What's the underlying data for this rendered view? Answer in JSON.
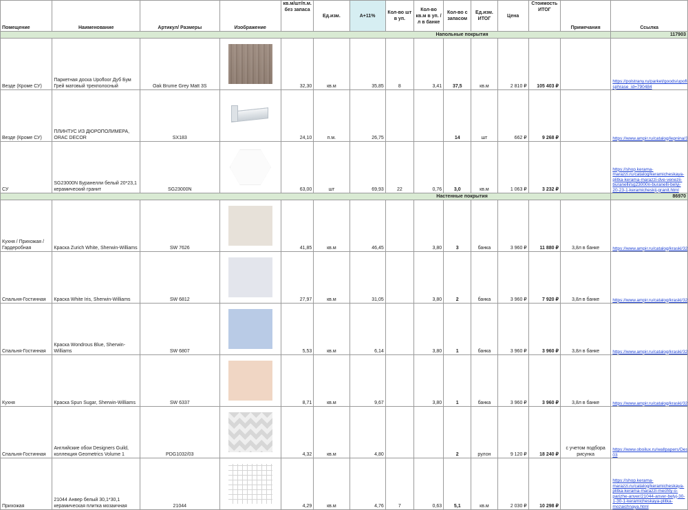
{
  "headers": {
    "room": "Помещение",
    "name": "Наименование",
    "article": "Артикул/ Размеры",
    "image": "Изображение",
    "qty": "кв.м/шт/п.м. без запаса",
    "unit": "Ед.изм.",
    "a11": "А+11%",
    "pcs_pack": "Кол-во шт в уп.",
    "sqm_pack": "Кол-во кв.м в уп. / л в банке",
    "qty_reserve": "Кол-во с запасом",
    "unit_total": "Ед.изм. ИТОГ",
    "price": "Цена",
    "cost": "Стоимость ИТОГ",
    "notes": "Примечания",
    "link": "Ссылка"
  },
  "colors": {
    "section_bg": "#d9ead3",
    "a11_bg": "#d6eef2",
    "link": "#1a3fd6"
  },
  "sections": [
    {
      "title": "Напольные покрытия",
      "total": "117903",
      "rows": [
        {
          "room": "Везде (Кроме СУ)",
          "name": "Паркетная доска Upofloor Дуб Бум Грей матовый трехполосный",
          "article": "Oak Brume Grey Matt 3S",
          "image": "wood-swatch",
          "qty": "32,30",
          "unit": "кв.м",
          "a11": "35,85",
          "pcs": "8",
          "sqm": "3,41",
          "reserve": "37,5",
          "unit_total": "кв.м",
          "price": "2 810 ₽",
          "cost": "105 403 ₽",
          "notes": "",
          "link": "https://polstrany.ru/parket/goods/upofloor_dub_bum_grey_matoviy_trekhpolosnyy_oak_brume_grey_matt_3s/?sphrase_id=790484"
        },
        {
          "room": "Везде (Кроме СУ)",
          "name": "ПЛИНТУС ИЗ ДЮРОПОЛИМЕРА, ORAC DECOR",
          "article": "SX183",
          "image": "plinth-image",
          "qty": "24,10",
          "unit": "п.м.",
          "a11": "26,75",
          "pcs": "",
          "sqm": "",
          "reserve": "14",
          "unit_total": "шт",
          "price": "662 ₽",
          "cost": "9 268 ₽",
          "notes": "",
          "link": "https://www.ampir.ru/catalog/lepnina/358619/"
        },
        {
          "room": "СУ",
          "name": "SG23000N Буранелли белый 20*23,1 керамический гранит",
          "article": "SG23000N",
          "image": "hex-tile",
          "qty": "63,00",
          "unit": "шт",
          "a11": "69,93",
          "pcs": "22",
          "sqm": "0,76",
          "reserve": "3,0",
          "unit_total": "кв.м",
          "price": "1 063 ₽",
          "cost": "3 232 ₽",
          "notes": "",
          "link": "https://shop.kerama-marazzi.ru/catalog/keramicheskaya-plitka-kerama-marazzi-dve-venezii-buranelli/sg23000n-buranelli-belyj-20-23-1-keramicheskij-granit.html"
        }
      ]
    },
    {
      "title": "Настенные покрытия",
      "total": "86970",
      "rows": [
        {
          "room": "Кухня / Прихожая / Гардеробная",
          "name": "Краска Zurich White, Sherwin-Williams",
          "article": "SW 7626",
          "image": "paint-swatch",
          "swatch": "#e7e1d9",
          "qty": "41,85",
          "unit": "кв.м",
          "a11": "46,45",
          "pcs": "",
          "sqm": "3,80",
          "reserve": "3",
          "unit_total": "банка",
          "price": "3 960 ₽",
          "cost": "11 880 ₽",
          "notes": "3,8л в банке",
          "link": "https://www.ampir.ru/catalog/kraski/328786/"
        },
        {
          "room": "Спальня-Гостинная",
          "name": "Краска White Iris, Sherwin-Williams",
          "article": "SW 6812",
          "image": "paint-swatch",
          "swatch": "#e3e5ec",
          "qty": "27,97",
          "unit": "кв.м",
          "a11": "31,05",
          "pcs": "",
          "sqm": "3,80",
          "reserve": "2",
          "unit_total": "банка",
          "price": "3 960 ₽",
          "cost": "7 920 ₽",
          "notes": "3,8л в банке",
          "link": "https://www.ampir.ru/catalog/kraski/328786/"
        },
        {
          "room": "Спальня-Гостинная",
          "name": "Краска Wondrous Blue, Sherwin-Williams",
          "article": "SW 6807",
          "image": "paint-swatch",
          "swatch": "#b9cbe6",
          "qty": "5,53",
          "unit": "кв.м",
          "a11": "6,14",
          "pcs": "",
          "sqm": "3,80",
          "reserve": "1",
          "unit_total": "банка",
          "price": "3 960 ₽",
          "cost": "3 960 ₽",
          "notes": "3,8л в банке",
          "link": "https://www.ampir.ru/catalog/kraski/328786/"
        },
        {
          "room": "Кухня",
          "name": "Краска Spun Sugar, Sherwin-Williams",
          "article": "SW 6337",
          "image": "paint-swatch",
          "swatch": "#f0d6c4",
          "qty": "8,71",
          "unit": "кв.м",
          "a11": "9,67",
          "pcs": "",
          "sqm": "3,80",
          "reserve": "1",
          "unit_total": "банка",
          "price": "3 960 ₽",
          "cost": "3 960 ₽",
          "notes": "3,8л в банке",
          "link": "https://www.ampir.ru/catalog/kraski/328786/"
        },
        {
          "room": "Спальня-Гостинная",
          "name": "Английские обои Designers Guild, коллекция Geometrics Volume 1",
          "article": "PDG1032/03",
          "image": "wallpaper-swatch",
          "qty": "4,32",
          "unit": "кв.м",
          "a11": "4,80",
          "pcs": "",
          "sqm": "",
          "reserve": "2",
          "unit_total": "рулон",
          "price": "9 120 ₽",
          "cost": "18 240 ₽",
          "notes": "с учетом подбора рисунка",
          "link": "https://www.oboilux.ru/wallpapers/Designersguild/Geometrics/PDG1032-03"
        },
        {
          "room": "Прихожая",
          "name": "21044 Анвер белый 30,1*30,1 керамическая плитка мозаичная",
          "article": "21044",
          "image": "mosaic-swatch",
          "qty": "4,29",
          "unit": "кв.м",
          "a11": "4,76",
          "pcs": "7",
          "sqm": "0,63",
          "reserve": "5,1",
          "unit_total": "кв.м",
          "price": "2 030 ₽",
          "cost": "10 298 ₽",
          "notes": "",
          "link": "https://shop.kerama-marazzi.ru/catalog/keramicheskaya-plitka-kerama-marazzi-mechty-o-parizhe-anver/21044-anver-belyj-30-1-30-1-keramicheskaya-plitka-mozaichnaya.html"
        }
      ]
    }
  ]
}
